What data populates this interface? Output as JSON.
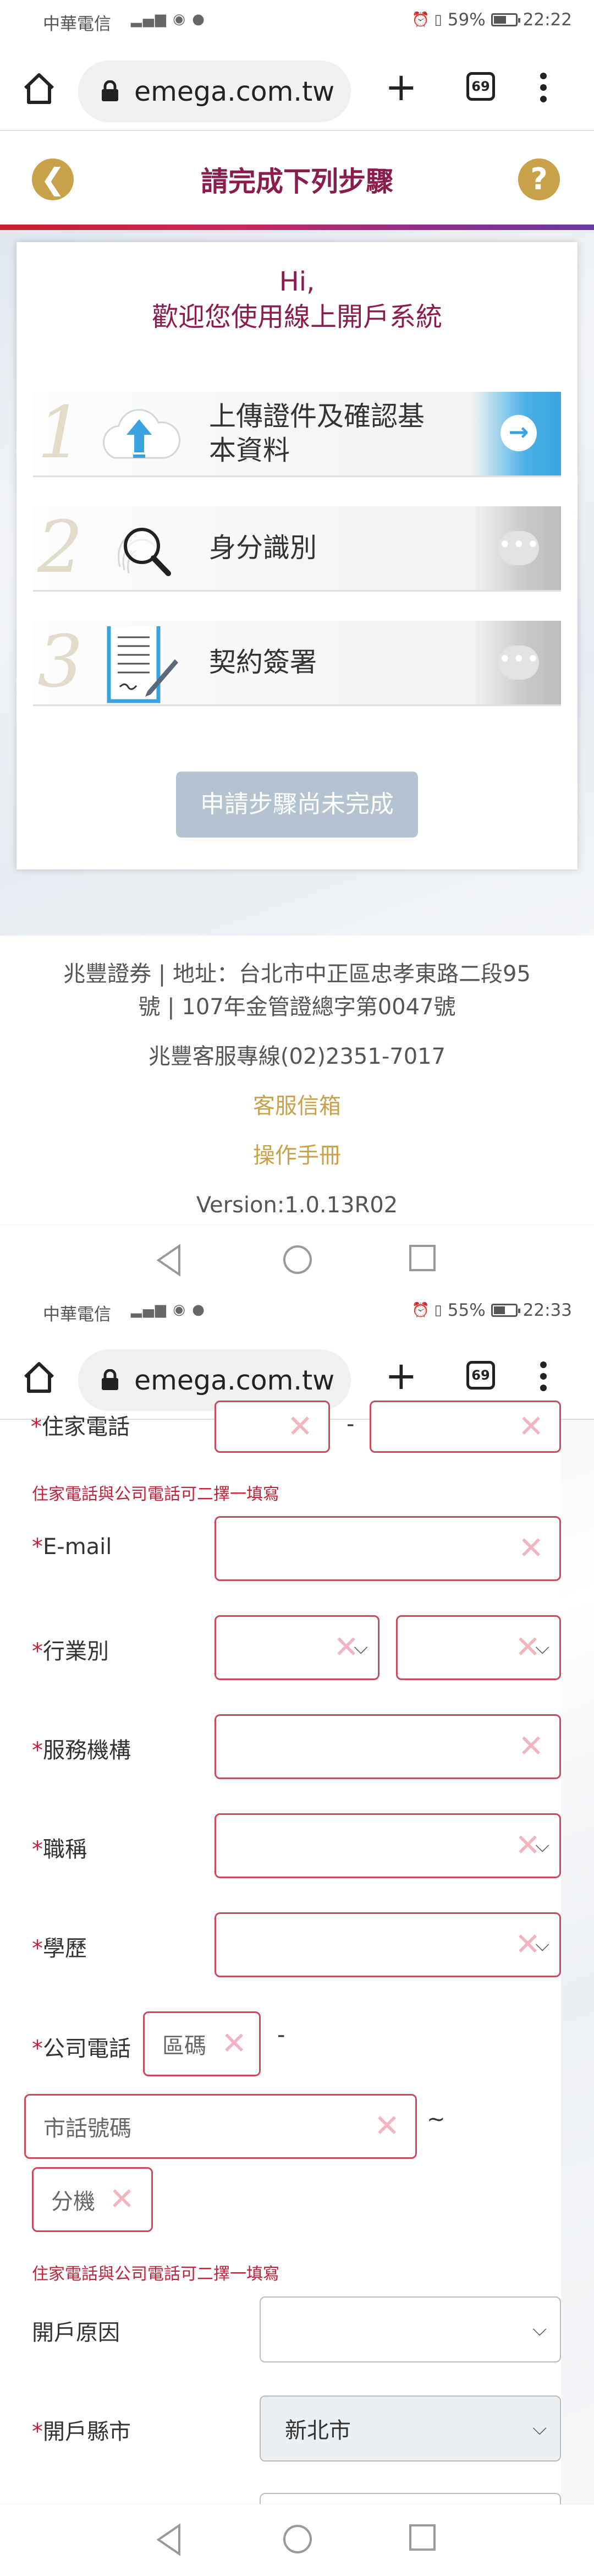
{
  "screen1": {
    "status": {
      "carrier": "中華電信",
      "battery": "59%",
      "battery_level": 0.59,
      "time": "22:22"
    },
    "browser": {
      "url": "emega.com.tw",
      "tab_count": "69"
    },
    "app": {
      "title": "請完成下列步驟",
      "back_icon": "❮",
      "help_icon": "?"
    },
    "greeting": {
      "line1": "Hi,",
      "line2": "歡迎您使用線上開戶系統"
    },
    "steps": [
      {
        "num": "1",
        "label_line1": "上傳證件及確認基",
        "label_line2": "本資料",
        "icon": "upload-cloud-icon"
      },
      {
        "num": "2",
        "label": "身分識別",
        "icon": "fingerprint-magnifier-icon"
      },
      {
        "num": "3",
        "label": "契約簽署",
        "icon": "contract-pen-icon"
      }
    ],
    "status_button": "申請步驟尚未完成",
    "footer": {
      "address_line1": "兆豐證券 | 地址：台北市中正區忠孝東路二段95",
      "address_line2": "號 | 107年金管證總字第0047號",
      "hotline": "兆豐客服專線(02)2351-7017",
      "email_link": "客服信箱",
      "manual_link": "操作手冊",
      "version": "Version:1.0.13R02"
    }
  },
  "screen2": {
    "status": {
      "carrier": "中華電信",
      "battery": "55%",
      "battery_level": 0.55,
      "time": "22:33"
    },
    "browser": {
      "url": "emega.com.tw",
      "tab_count": "69"
    },
    "form": {
      "home_phone_label": "住家電話",
      "hint1": "住家電話與公司電話可二擇一填寫",
      "email_label": "E-mail",
      "industry_label": "行業別",
      "org_label": "服務機構",
      "title_label": "職稱",
      "education_label": "學歷",
      "company_phone_label": "公司電話",
      "area_code_placeholder": "區碼",
      "phone_placeholder": "市話號碼",
      "extension_placeholder": "分機",
      "hint2": "住家電話與公司電話可二擇一填寫",
      "reason_label": "開戶原因",
      "city_label": "開戶縣市",
      "city_value": "新北市",
      "dash": "-",
      "tilde": "~",
      "required_mark": "*"
    }
  },
  "colors": {
    "accent": "#8b1c4e",
    "gold": "#c9a14a",
    "required": "#c0223a",
    "step_blue": "#3aa3df"
  }
}
